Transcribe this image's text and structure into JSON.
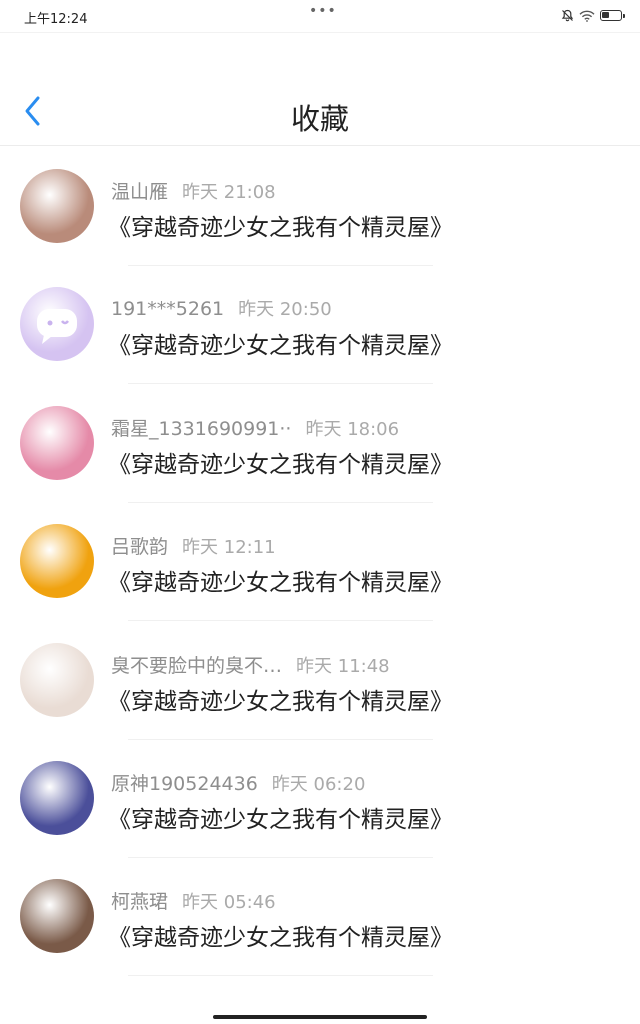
{
  "status_bar": {
    "time": "上午12:24",
    "dots": "•••",
    "battery_level": 0.4
  },
  "header": {
    "title": "收藏"
  },
  "favorites": [
    {
      "username": "温山雁",
      "time": "昨天 21:08",
      "book": "《穿越奇迹少女之我有个精灵屋》",
      "avatar_color": "#b98b7a"
    },
    {
      "username": "191***5261",
      "time": "昨天 20:50",
      "book": "《穿越奇迹少女之我有个精灵屋》",
      "avatar_color": "#d5c3f1"
    },
    {
      "username": "霜星_1331690991··",
      "time": "昨天 18:06",
      "book": "《穿越奇迹少女之我有个精灵屋》",
      "avatar_color": "#e58aa8"
    },
    {
      "username": "吕歌韵",
      "time": "昨天 12:11",
      "book": "《穿越奇迹少女之我有个精灵屋》",
      "avatar_color": "#f0a20f"
    },
    {
      "username": "臭不要脸中的臭不…",
      "time": "昨天 11:48",
      "book": "《穿越奇迹少女之我有个精灵屋》",
      "avatar_color": "#e9dcd4"
    },
    {
      "username": "原神190524436",
      "time": "昨天 06:20",
      "book": "《穿越奇迹少女之我有个精灵屋》",
      "avatar_color": "#4b4f9a"
    },
    {
      "username": "柯燕珺",
      "time": "昨天 05:46",
      "book": "《穿越奇迹少女之我有个精灵屋》",
      "avatar_color": "#7a5a48"
    }
  ]
}
